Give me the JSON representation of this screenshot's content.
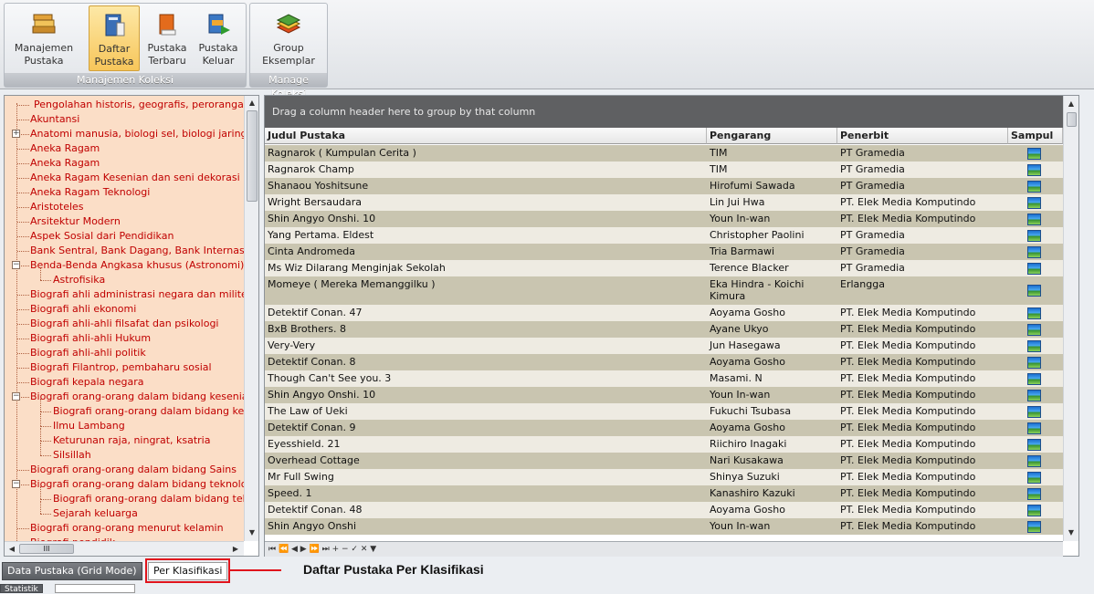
{
  "ribbon": {
    "groups": [
      {
        "caption": "Manajemen Koleksi",
        "buttons": [
          {
            "label": "Manajemen\nPustaka",
            "icon": "book-stack-icon",
            "active": false
          },
          {
            "label": "Daftar\nPustaka",
            "icon": "book-list-icon",
            "active": true
          },
          {
            "label": "Pustaka\nTerbaru",
            "icon": "new-book-icon",
            "active": false
          },
          {
            "label": "Pustaka\nKeluar",
            "icon": "book-out-icon",
            "active": false
          }
        ]
      },
      {
        "caption": "Manage Koleksi",
        "buttons": [
          {
            "label": "Group\nEksemplar",
            "icon": "book-group-icon",
            "active": false
          }
        ]
      }
    ]
  },
  "tree": {
    "items": [
      {
        "label": "Pengolahan historis, geografis, perorangan",
        "level": 0,
        "expander": null
      },
      {
        "label": "Akuntansi",
        "level": 0,
        "expander": null
      },
      {
        "label": "Anatomi manusia, biologi sel, biologi jaringan",
        "level": 0,
        "expander": "+"
      },
      {
        "label": "Aneka Ragam",
        "level": 0,
        "expander": null
      },
      {
        "label": "Aneka Ragam",
        "level": 0,
        "expander": null
      },
      {
        "label": "Aneka Ragam Kesenian dan seni dekorasi",
        "level": 0,
        "expander": null
      },
      {
        "label": "Aneka Ragam Teknologi",
        "level": 0,
        "expander": null
      },
      {
        "label": "Aristoteles",
        "level": 0,
        "expander": null
      },
      {
        "label": "Arsitektur Modern",
        "level": 0,
        "expander": null
      },
      {
        "label": "Aspek Sosial dari Pendidikan",
        "level": 0,
        "expander": null
      },
      {
        "label": "Bank Sentral, Bank Dagang, Bank Internasional",
        "level": 0,
        "expander": null
      },
      {
        "label": "Benda-Benda Angkasa khusus (Astronomi)",
        "level": 0,
        "expander": "-"
      },
      {
        "label": "Astrofisika",
        "level": 1,
        "expander": null
      },
      {
        "label": "Biografi ahli administrasi negara dan militer",
        "level": 0,
        "expander": null
      },
      {
        "label": "Biografi ahli ekonomi",
        "level": 0,
        "expander": null
      },
      {
        "label": "Biografi ahli-ahli filsafat dan psikologi",
        "level": 0,
        "expander": null
      },
      {
        "label": "Biografi ahli-ahli Hukum",
        "level": 0,
        "expander": null
      },
      {
        "label": "Biografi ahli-ahli politik",
        "level": 0,
        "expander": null
      },
      {
        "label": "Biografi Filantrop, pembaharu sosial",
        "level": 0,
        "expander": null
      },
      {
        "label": "Biografi kepala negara",
        "level": 0,
        "expander": null
      },
      {
        "label": "Biografi orang-orang dalam bidang kesenian",
        "level": 0,
        "expander": "-"
      },
      {
        "label": "Biografi orang-orang dalam bidang kesenian",
        "level": 1,
        "expander": null
      },
      {
        "label": "Ilmu Lambang",
        "level": 1,
        "expander": null
      },
      {
        "label": "Keturunan raja, ningrat, ksatria",
        "level": 1,
        "expander": null
      },
      {
        "label": "Silsillah",
        "level": 1,
        "expander": null
      },
      {
        "label": "Biografi orang-orang dalam bidang Sains",
        "level": 0,
        "expander": null
      },
      {
        "label": "Biografi orang-orang dalam bidang teknologi",
        "level": 0,
        "expander": "-"
      },
      {
        "label": "Biografi orang-orang dalam bidang teknologi",
        "level": 1,
        "expander": null
      },
      {
        "label": "Sejarah keluarga",
        "level": 1,
        "expander": null
      },
      {
        "label": "Biografi orang-orang menurut kelamin",
        "level": 0,
        "expander": null
      },
      {
        "label": "Biografi pendidik",
        "level": 0,
        "expander": null
      }
    ],
    "hscroll_grip": "III"
  },
  "grid": {
    "group_hint": "Drag a column header here to group by that column",
    "columns": [
      "Judul Pustaka",
      "Pengarang",
      "Penerbit",
      "Sampul"
    ],
    "rows": [
      [
        "Ragnarok ( Kumpulan Cerita )",
        "TIM",
        "PT Gramedia"
      ],
      [
        "Ragnarok Champ",
        "TIM",
        "PT Gramedia"
      ],
      [
        "Shanaou Yoshitsune",
        "Hirofumi Sawada",
        "PT Gramedia"
      ],
      [
        "Wright Bersaudara",
        "Lin Jui Hwa",
        "PT. Elek Media Komputindo"
      ],
      [
        "Shin Angyo Onshi. 10",
        "Youn In-wan",
        "PT. Elek Media Komputindo"
      ],
      [
        "Yang Pertama. Eldest",
        "Christopher Paolini",
        "PT Gramedia"
      ],
      [
        "Cinta Andromeda",
        "Tria Barmawi",
        "PT Gramedia"
      ],
      [
        "Ms Wiz Dilarang Menginjak Sekolah",
        "Terence Blacker",
        "PT Gramedia"
      ],
      [
        "Momeye ( Mereka Memanggilku )",
        "Eka Hindra - Koichi Kimura",
        "Erlangga"
      ],
      [
        "Detektif Conan. 47",
        "Aoyama Gosho",
        "PT. Elek Media Komputindo"
      ],
      [
        "BxB Brothers. 8",
        "Ayane Ukyo",
        "PT. Elek Media Komputindo"
      ],
      [
        "Very-Very",
        "Jun Hasegawa",
        "PT. Elek Media Komputindo"
      ],
      [
        "Detektif Conan. 8",
        "Aoyama Gosho",
        "PT. Elek Media Komputindo"
      ],
      [
        "Though Can't See you. 3",
        "Masami. N",
        "PT. Elek Media Komputindo"
      ],
      [
        "Shin Angyo Onshi. 10",
        "Youn In-wan",
        "PT. Elek Media Komputindo"
      ],
      [
        "The Law of Ueki",
        "Fukuchi Tsubasa",
        "PT. Elek Media Komputindo"
      ],
      [
        "Detektif Conan. 9",
        "Aoyama Gosho",
        "PT. Elek Media Komputindo"
      ],
      [
        "Eyesshield. 21",
        "Riichiro Inagaki",
        "PT. Elek Media Komputindo"
      ],
      [
        "Overhead Cottage",
        "Nari Kusakawa",
        "PT. Elek Media Komputindo"
      ],
      [
        "Mr Full Swing",
        "Shinya Suzuki",
        "PT. Elek Media Komputindo"
      ],
      [
        "Speed. 1",
        "Kanashiro Kazuki",
        "PT. Elek Media Komputindo"
      ],
      [
        "Detektif Conan. 48",
        "Aoyama Gosho",
        "PT. Elek Media Komputindo"
      ],
      [
        "Shin Angyo Onshi",
        "Youn In-wan",
        "PT. Elek Media Komputindo"
      ]
    ],
    "cover_icon": "cover-image-icon",
    "nav_glyphs": "⏮ ⏪ ◀ ▶ ⏩ ⏭ + − ✓ ✕ ▼"
  },
  "tabs": {
    "grid_mode": "Data Pustaka (Grid Mode)",
    "per_class": "Per Klasifikasi",
    "statistik": "Statistik"
  },
  "annotation": {
    "text": "Daftar Pustaka Per Klasifikasi",
    "color": "#e0141c"
  },
  "colors": {
    "tree_bg": "#fbdec7",
    "tree_text": "#c00000",
    "row_odd": "#c9c5b0",
    "row_even": "#eeebe2",
    "group_bar": "#5f6062"
  }
}
